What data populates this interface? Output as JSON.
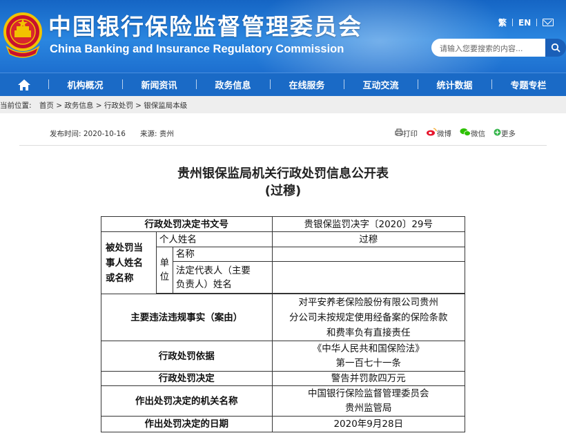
{
  "header": {
    "title_cn": "中国银行保险监督管理委员会",
    "title_en": "China Banking and Insurance Regulatory Commission",
    "lang_traditional": "繁",
    "lang_en": "EN",
    "search_placeholder": "请输入您要搜索的内容...",
    "colors": {
      "header_blue": "#1d6fcf",
      "nav_blue": "#1a6ac6"
    }
  },
  "nav": {
    "items": [
      "机构概况",
      "新闻资讯",
      "政务信息",
      "在线服务",
      "互动交流",
      "统计数据",
      "专题专栏"
    ]
  },
  "breadcrumb": {
    "label": "当前位置:",
    "path": "首页 > 政务信息 > 行政处罚 > 银保监局本级"
  },
  "meta": {
    "publish": "发布时间:  2020-10-16",
    "source": "来源:  贵州",
    "share": {
      "print": "打印",
      "weibo": "微博",
      "wechat": "微信",
      "more": "更多"
    }
  },
  "document": {
    "title": "贵州银保监局机关行政处罚信息公开表",
    "subtitle": "(过穆)"
  },
  "table": {
    "decision_no_label": "行政处罚决定书文号",
    "decision_no": "贵银保监罚决字〔2020〕29号",
    "party_label_1": "被处罚当",
    "party_label_2": "事人姓名",
    "party_label_3": "或名称",
    "individual_label": "个人姓名",
    "individual_name": "过穆",
    "unit_label_1": "单",
    "unit_label_2": "位",
    "unit_name_label": "名称",
    "unit_name": "",
    "legal_rep_label_1": "法定代表人（主要",
    "legal_rep_label_2": "负责人）姓名",
    "legal_rep": "",
    "facts_label": "主要违法违规事实（案由）",
    "facts_1": "对平安养老保险股份有限公司贵州",
    "facts_2": "分公司未按规定使用经备案的保险条款",
    "facts_3": "和费率负有直接责任",
    "basis_label": "行政处罚依据",
    "basis_1": "《中华人民共和国保险法》",
    "basis_2": "第一百七十一条",
    "decision_label": "行政处罚决定",
    "decision": "警告并罚款四万元",
    "authority_label": "作出处罚决定的机关名称",
    "authority_1": "中国银行保险监督管理委员会",
    "authority_2": "贵州监管局",
    "date_label": "作出处罚决定的日期",
    "date": "2020年9月28日"
  }
}
